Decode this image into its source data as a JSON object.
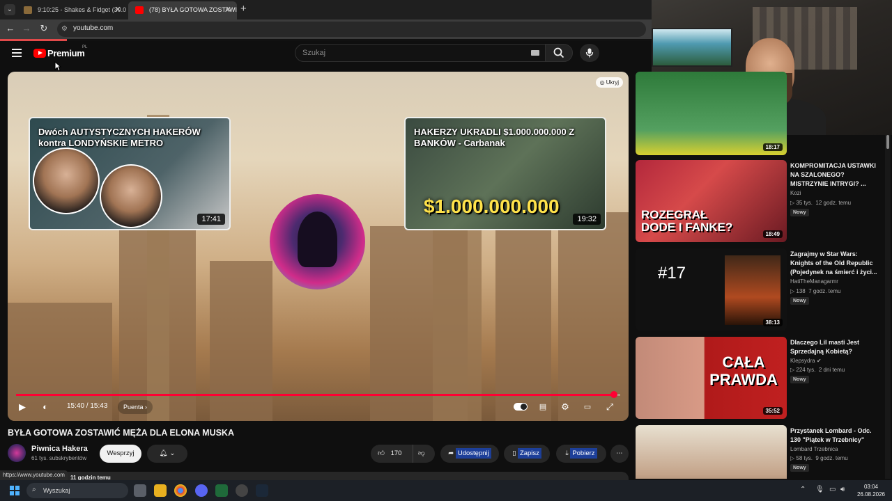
{
  "browser": {
    "tabs": [
      {
        "title": "9:10:25 - Shakes & Fidget (30.0…",
        "active": false
      },
      {
        "title": "(78) BYŁA GOTOWA ZOSTAWIĆ…",
        "active": true
      }
    ],
    "new_tab": "+",
    "url": "youtube.com",
    "status_url": "https://www.youtube.com"
  },
  "youtube": {
    "logo_text": "Premium",
    "logo_country": "PL",
    "search_placeholder": "Szukaj"
  },
  "player": {
    "hide_label": "Ukryj",
    "endcards": [
      {
        "title": "Dwóch AUTYSTYCZNYCH HAKERÓW kontra LONDYŃSKIE METRO",
        "duration": "17:41"
      },
      {
        "title": "HAKERZY UKRADLI $1.000.000.000 Z BANKÓW - Carbanak",
        "duration": "19:32",
        "overlay_text": "$1.000.000.000"
      }
    ],
    "time": "15:40 / 15:43",
    "progress": 0.99,
    "next_label": "Puenta"
  },
  "video": {
    "title": "BYŁA GOTOWA ZOSTAWIĆ MĘŻA DLA ELONA MUSKA",
    "channel": "Piwnica Hakera",
    "subscribers": "61 tys. subskrybentów",
    "support_label": "Wesprzyj",
    "likes": "170",
    "share_label": "Udostępnij",
    "save_label": "Zapisz",
    "download_label": "Pobierz",
    "posted": "11 godzin temu"
  },
  "sidebar": [
    {
      "duration": "18:17"
    },
    {
      "title": "KOMPROMITACJA USTAWKI NA SZALONEGO? MISTRZYNIE INTRYGI? ...",
      "channel": "Kozi",
      "views": "35 tys.",
      "age": "12 godz. temu",
      "badge": "Nowy",
      "duration": "18:49",
      "thumb_text": "ROZEGRAŁ DODE I FANKE?"
    },
    {
      "title": "Zagrajmy w Star Wars: Knights of the Old Republic (Pojedynek na śmierć i życi...",
      "channel": "HatiTheManagarmr",
      "views": "138",
      "age": "7 godz. temu",
      "badge": "Nowy",
      "duration": "38:13",
      "thumb_text": "#17"
    },
    {
      "title": "Dlaczego Lil masti Jest Sprzedajną Kobietą?",
      "channel": "Klepsydra",
      "views": "224 tys.",
      "age": "2 dni temu",
      "badge": "Nowy",
      "duration": "35:52",
      "thumb_text": "CAŁA PRAWDA"
    },
    {
      "title": "Przystanek Lombard - Odc. 130 \"Piątek w Trzebnicy\"",
      "channel": "Lombard Trzebnica",
      "views": "58 tys.",
      "age": "9 godz. temu",
      "badge": "Nowy"
    }
  ],
  "taskbar": {
    "search_label": "Wyszukaj",
    "time": "03:04",
    "date": "26.08.2026"
  }
}
